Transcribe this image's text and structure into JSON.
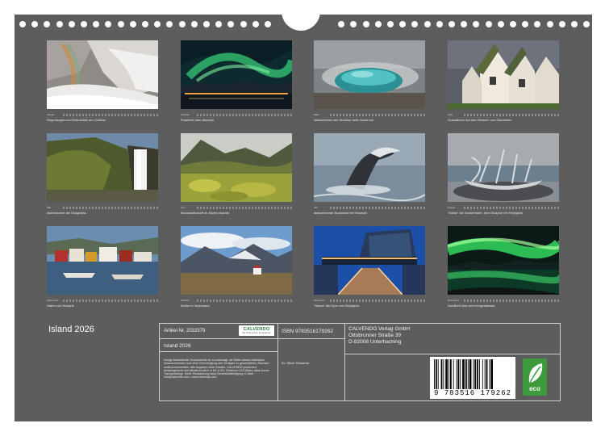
{
  "calendar_title": "Island 2026",
  "months": [
    {
      "mini_month": "Januar",
      "caption": "Regenbogen und Eiskristalle am Gullfoss"
    },
    {
      "mini_month": "Februar",
      "caption": "Polarlicht über Akureyri"
    },
    {
      "mini_month": "März",
      "caption": "Wasserblase des Strokkur beim Ausbruch"
    },
    {
      "mini_month": "April",
      "caption": "Grasdächer auf den Häusern von Glaumbær"
    },
    {
      "mini_month": "Mai",
      "caption": "Abendsonne am Skógafoss"
    },
    {
      "mini_month": "Juni",
      "caption": "Mooslandschaft im Süden Islands"
    },
    {
      "mini_month": "Juli",
      "caption": "abtauchender Buckelwal bei Húsavík"
    },
    {
      "mini_month": "August",
      "caption": "\"Sólfar\" die Sonnenfahrt, eine Skulptur bei Reykjavík"
    },
    {
      "mini_month": "September",
      "caption": "Hafen von Húsavík"
    },
    {
      "mini_month": "Oktober",
      "caption": "Kirche in Vesturland"
    },
    {
      "mini_month": "November",
      "caption": "\"Harpa\" die Oper von Reykjavík"
    },
    {
      "mini_month": "Dezember",
      "caption": "Nordlicht über dem Þingvallavatn"
    }
  ],
  "imprint": {
    "article_no": "Artikel-Nr. 2032579",
    "product_title": "Island 2026",
    "logo_brand": "CALVENDO",
    "logo_sub": "Ein Unternehmen der Apple AG",
    "notice": "Infolge bestehender Schutzrechte ist es untersagt, die Bilder dieses Kalenders herauszutrennen und ohne Genehmigung des Verlages zu gewerblichen Zwecken weiterzuverwenden. Alle Angaben ohne Gewähr. CALVENDO-produziert bedarfsgerecht und klimafreundlich in DE & EU. Positiven CO2-Bilanz dank kurzer Transportwege. Mehr: Reduzierung dank Einzelstückfertigung. E-Mail: info@calvendo.com • www.calvendo.com",
    "isbn": "ISBN 9783516179262",
    "author": "Dr. Oliver Schwenn",
    "publisher_name": "CALVENDO Verlag GmbH",
    "publisher_street": "Ottobrunner Straße 39",
    "publisher_city": "D-82008 Unterhaching",
    "barcode_digits": "9 783516 179262",
    "eco_label": "eco"
  },
  "colors": {
    "background": "#5d5d5d",
    "frame": "#cfcfcf",
    "eco_green": "#3e9a3c"
  },
  "icons": [
    "binding-hole",
    "hanger-notch",
    "calvendo-logo",
    "barcode",
    "eco-leaf-icon"
  ]
}
